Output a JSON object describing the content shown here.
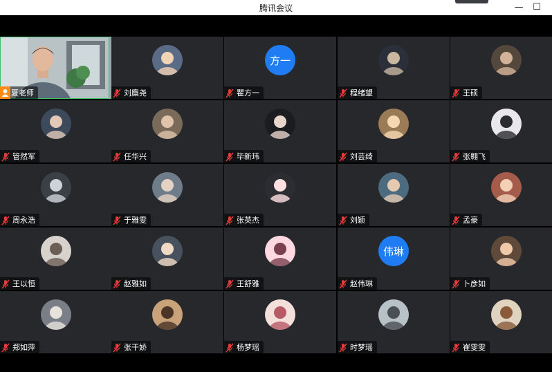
{
  "window": {
    "title": "腾讯会议",
    "minimize_glyph": "—",
    "maximize_glyph": "☐",
    "pill_color": "#3a3d42"
  },
  "colors": {
    "tile_bg": "#26282c",
    "active_speaker_border": "#3cc36a",
    "text_avatar_bg": "#1f7cf2",
    "mic_muted": "#e43b3b",
    "host_badge": "#ff8a16"
  },
  "participants": [
    {
      "name": "夏老师",
      "avatar": "video",
      "mic": "on",
      "host": true
    },
    {
      "name": "刘麋尧",
      "avatar": "photo",
      "mic": "muted"
    },
    {
      "name": "瞿方一",
      "avatar": "text",
      "avatar_text": "方一",
      "mic": "muted"
    },
    {
      "name": "程绪望",
      "avatar": "photo",
      "mic": "muted"
    },
    {
      "name": "王硕",
      "avatar": "photo",
      "mic": "muted"
    },
    {
      "name": "管然军",
      "avatar": "photo",
      "mic": "muted"
    },
    {
      "name": "任华兴",
      "avatar": "photo",
      "mic": "muted"
    },
    {
      "name": "毕新玮",
      "avatar": "photo",
      "mic": "muted"
    },
    {
      "name": "刘芸绮",
      "avatar": "photo",
      "mic": "muted"
    },
    {
      "name": "张翱飞",
      "avatar": "photo",
      "mic": "muted"
    },
    {
      "name": "周永浩",
      "avatar": "photo",
      "mic": "muted"
    },
    {
      "name": "于雅雯",
      "avatar": "photo",
      "mic": "muted"
    },
    {
      "name": "张英杰",
      "avatar": "photo",
      "mic": "muted"
    },
    {
      "name": "刘颖",
      "avatar": "photo",
      "mic": "muted"
    },
    {
      "name": "孟豪",
      "avatar": "photo",
      "mic": "muted"
    },
    {
      "name": "王以恒",
      "avatar": "photo",
      "mic": "muted"
    },
    {
      "name": "赵雅如",
      "avatar": "photo",
      "mic": "muted"
    },
    {
      "name": "王舒雅",
      "avatar": "photo",
      "mic": "muted"
    },
    {
      "name": "赵伟琳",
      "avatar": "text",
      "avatar_text": "伟琳",
      "mic": "muted"
    },
    {
      "name": "卜彦如",
      "avatar": "photo",
      "mic": "muted"
    },
    {
      "name": "郑如萍",
      "avatar": "photo",
      "mic": "muted"
    },
    {
      "name": "张干娇",
      "avatar": "photo",
      "mic": "muted"
    },
    {
      "name": "杨梦瑶",
      "avatar": "photo",
      "mic": "muted"
    },
    {
      "name": "时梦瑶",
      "avatar": "photo",
      "mic": "muted"
    },
    {
      "name": "崔雯雯",
      "avatar": "photo",
      "mic": "muted"
    }
  ]
}
